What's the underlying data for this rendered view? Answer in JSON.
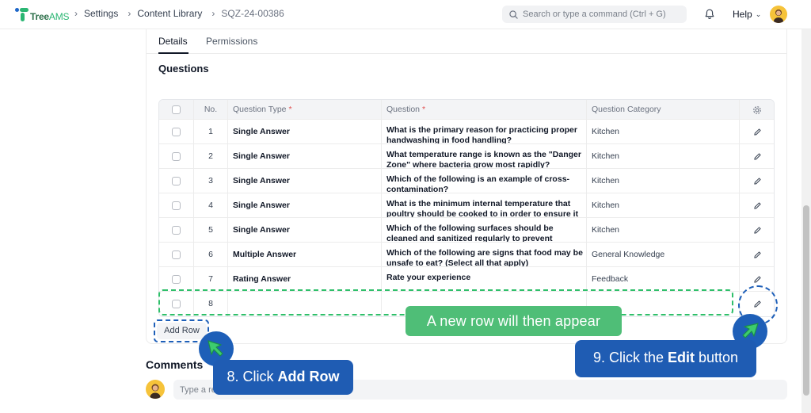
{
  "topbar": {
    "logo_brand": "Tree",
    "logo_suffix": "AMS",
    "breadcrumbs": [
      "Settings",
      "Content Library",
      "SQZ-24-00386"
    ],
    "search_placeholder": "Search or type a command (Ctrl + G)",
    "help_label": "Help"
  },
  "tabs": [
    "Details",
    "Permissions"
  ],
  "section_title": "Questions",
  "table": {
    "columns": {
      "no": "No.",
      "type": "Question Type",
      "question": "Question",
      "category": "Question Category",
      "required_mark": "*"
    },
    "rows": [
      {
        "no": "1",
        "type": "Single Answer",
        "question": "What is the primary reason for practicing proper handwashing in food handling?",
        "category": "Kitchen"
      },
      {
        "no": "2",
        "type": "Single Answer",
        "question": "What temperature range is known as the \"Danger Zone\" where bacteria grow most rapidly?",
        "category": "Kitchen"
      },
      {
        "no": "3",
        "type": "Single Answer",
        "question": "Which of the following is an example of cross-contamination?",
        "category": "Kitchen"
      },
      {
        "no": "4",
        "type": "Single Answer",
        "question": "What is the minimum internal temperature that poultry should be cooked to in order to ensure it is",
        "category": "Kitchen"
      },
      {
        "no": "5",
        "type": "Single Answer",
        "question": "Which of the following surfaces should be cleaned and sanitized regularly to prevent contamination?",
        "category": "Kitchen"
      },
      {
        "no": "6",
        "type": "Multiple Answer",
        "question": "Which of the following are signs that food may be unsafe to eat? (Select all that apply)",
        "category": "General Knowledge"
      },
      {
        "no": "7",
        "type": "Rating Answer",
        "question": "Rate your experience",
        "category": "Feedback"
      },
      {
        "no": "8",
        "type": "",
        "question": "",
        "category": ""
      }
    ],
    "add_row_label": "Add Row"
  },
  "comments": {
    "title": "Comments",
    "placeholder": "Type a reply / comment"
  },
  "annotations": {
    "new_row_callout": "A new row will then appear",
    "step8_prefix": "8. Click ",
    "step8_bold": "Add Row",
    "step9_prefix": "9. Click the ",
    "step9_bold": "Edit",
    "step9_suffix": " button"
  },
  "colors": {
    "annotation_blue": "#1f5cb3",
    "annotation_green": "#4fbe77",
    "required_red": "#e05252"
  }
}
